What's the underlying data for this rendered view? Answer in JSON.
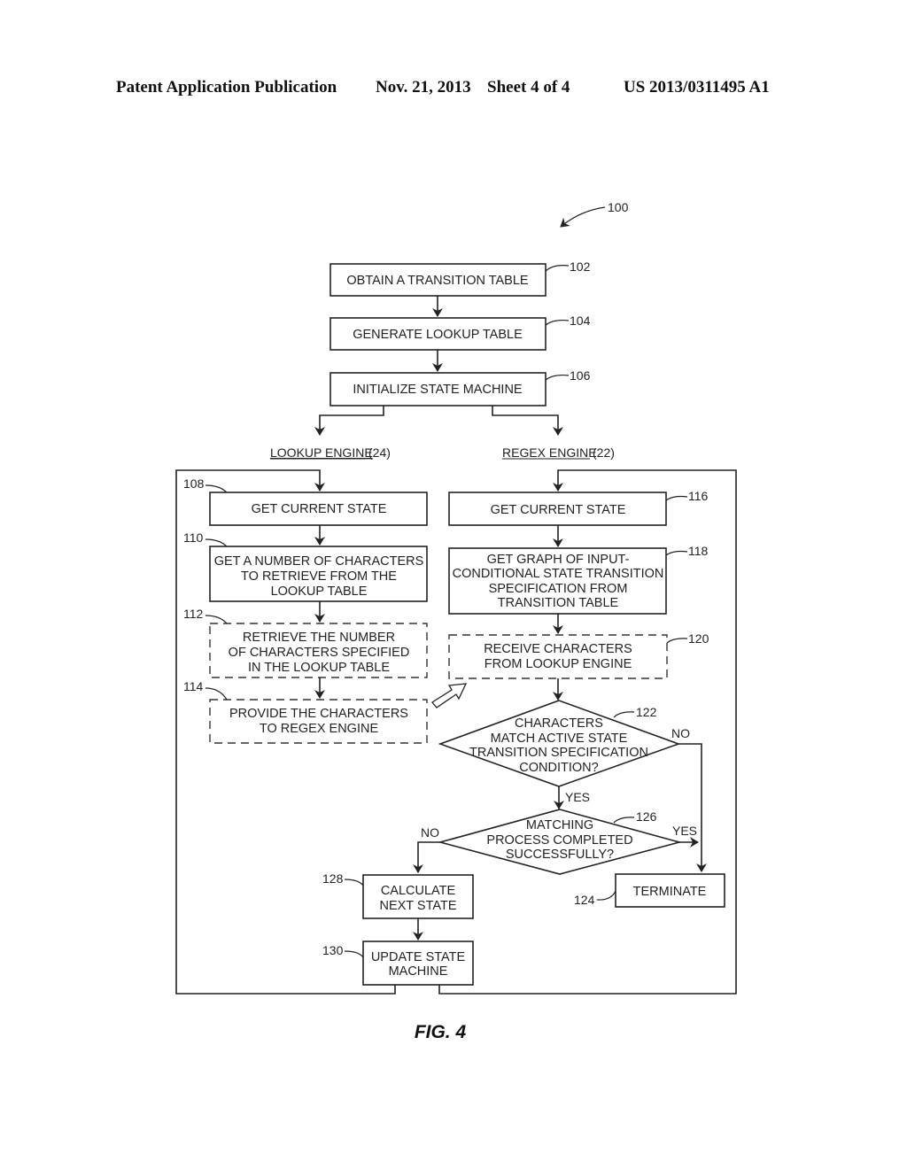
{
  "header": {
    "left": "Patent Application Publication",
    "date": "Nov. 21, 2013",
    "sheet": "Sheet 4 of 4",
    "number": "US 2013/0311495 A1"
  },
  "figure": {
    "caption": "FIG. 4",
    "ref_overall": "100",
    "top_steps": [
      {
        "ref": "102",
        "text": [
          "OBTAIN A TRANSITION TABLE"
        ]
      },
      {
        "ref": "104",
        "text": [
          "GENERATE LOOKUP TABLE"
        ]
      },
      {
        "ref": "106",
        "text": [
          "INITIALIZE STATE MACHINE"
        ]
      }
    ],
    "lanes": {
      "lookup": {
        "name": "LOOKUP ENGINE",
        "ref": "(24)"
      },
      "regex": {
        "name": "REGEX ENGINE",
        "ref": "(22)"
      }
    },
    "lookup_steps": [
      {
        "ref": "108",
        "text": [
          "GET CURRENT STATE"
        ]
      },
      {
        "ref": "110",
        "text": [
          "GET A NUMBER OF CHARACTERS",
          "TO RETRIEVE FROM THE",
          "LOOKUP TABLE"
        ]
      },
      {
        "ref": "112",
        "text": [
          "RETRIEVE THE NUMBER",
          "OF CHARACTERS SPECIFIED",
          "IN THE LOOKUP TABLE"
        ]
      },
      {
        "ref": "114",
        "text": [
          "PROVIDE THE CHARACTERS",
          "TO REGEX ENGINE"
        ]
      }
    ],
    "regex_steps": [
      {
        "ref": "116",
        "text": [
          "GET CURRENT STATE"
        ]
      },
      {
        "ref": "118",
        "text": [
          "GET GRAPH OF INPUT-",
          "CONDITIONAL STATE TRANSITION",
          "SPECIFICATION FROM",
          "TRANSITION TABLE"
        ]
      },
      {
        "ref": "120",
        "text": [
          "RECEIVE CHARACTERS",
          "FROM LOOKUP ENGINE"
        ]
      }
    ],
    "decisions": [
      {
        "ref": "122",
        "text": [
          "CHARACTERS",
          "MATCH ACTIVE STATE",
          "TRANSITION SPECIFICATION",
          "CONDITION?"
        ],
        "yes": "YES",
        "no": "NO"
      },
      {
        "ref": "126",
        "text": [
          "MATCHING",
          "PROCESS COMPLETED",
          "SUCCESSFULLY?"
        ],
        "yes": "YES",
        "no": "NO"
      }
    ],
    "end_steps": [
      {
        "ref": "124",
        "text": [
          "TERMINATE"
        ]
      },
      {
        "ref": "128",
        "text": [
          "CALCULATE",
          "NEXT STATE"
        ]
      },
      {
        "ref": "130",
        "text": [
          "UPDATE STATE",
          "MACHINE"
        ]
      }
    ]
  }
}
